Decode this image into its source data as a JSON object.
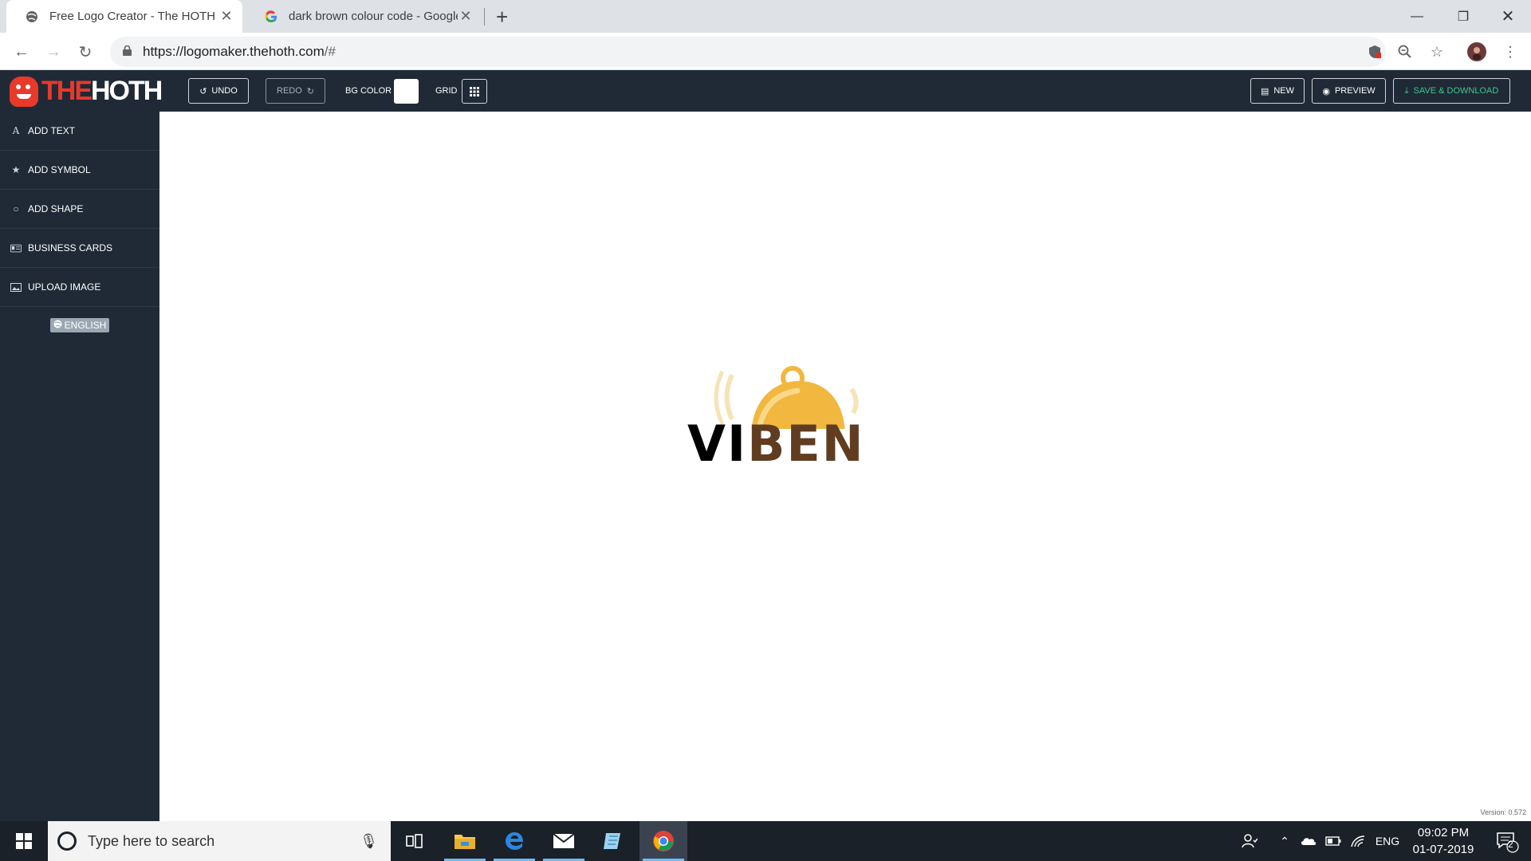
{
  "browser": {
    "tabs": [
      {
        "title": "Free Logo Creator - The HOTH",
        "active": true
      },
      {
        "title": "dark brown colour code - Google",
        "active": false
      }
    ],
    "url_host": "https://logomaker.thehoth.com",
    "url_rest": "/#"
  },
  "app": {
    "logo": {
      "the": "THE",
      "hoth": "HOTH"
    },
    "toolbar": {
      "undo": "UNDO",
      "redo": "REDO",
      "bg_color_label": "BG COLOR",
      "bg_color_value": "#ffffff",
      "grid_label": "GRID",
      "new": "NEW",
      "preview": "PREVIEW",
      "save_download": "SAVE & DOWNLOAD"
    },
    "sidebar": {
      "items": [
        {
          "label": "ADD TEXT",
          "icon": "text-icon"
        },
        {
          "label": "ADD SYMBOL",
          "icon": "star-icon"
        },
        {
          "label": "ADD SHAPE",
          "icon": "circle-icon"
        },
        {
          "label": "BUSINESS CARDS",
          "icon": "business-card-icon"
        },
        {
          "label": "UPLOAD IMAGE",
          "icon": "image-icon"
        }
      ],
      "language": "ENGLISH"
    },
    "canvas": {
      "logo_text_black": "VI",
      "logo_text_brown": "BEN",
      "colors": {
        "bell_gold": "#f2b73e",
        "bell_brown": "#6b4424",
        "text_brown": "#603c21"
      },
      "version": "Version: 0.572"
    }
  },
  "taskbar": {
    "search_placeholder": "Type here to search",
    "language": "ENG",
    "time": "09:02 PM",
    "date": "01-07-2019",
    "notification_count": "2"
  }
}
